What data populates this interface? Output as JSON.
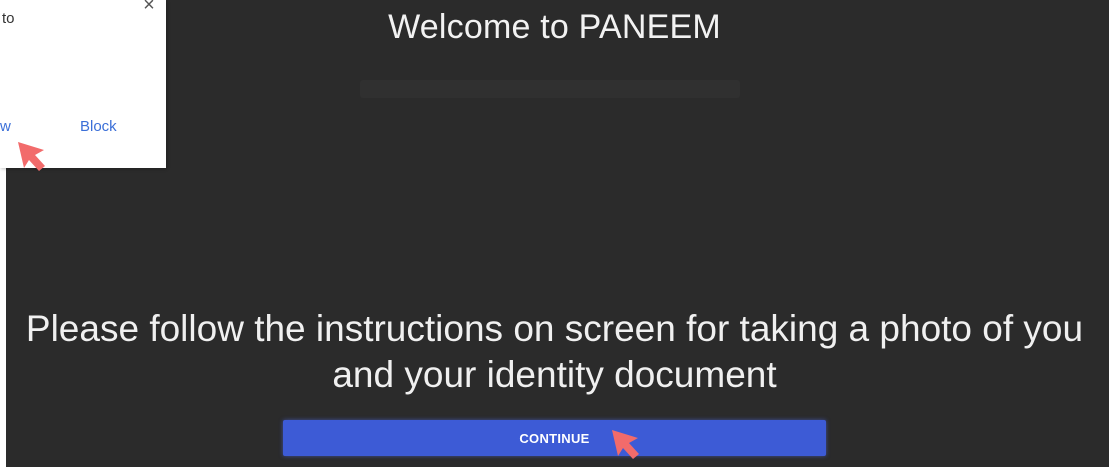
{
  "welcome_title": "Welcome to PANEEM",
  "instructions": "Please follow the instructions on screen for taking a photo of you and your identity document",
  "continue_button": "CONTINUE",
  "permission_popup": {
    "text_fragment": "to",
    "close_glyph": "×",
    "allow_fragment": "w",
    "block_label": "Block"
  },
  "annotations": {
    "arrow_color": "#f26b6b",
    "arrow_icon": "arrow-pointer-icon"
  },
  "colors": {
    "screen_background": "#2b2b2b",
    "button_background": "#3d5bd6",
    "link": "#3b6fd8"
  }
}
